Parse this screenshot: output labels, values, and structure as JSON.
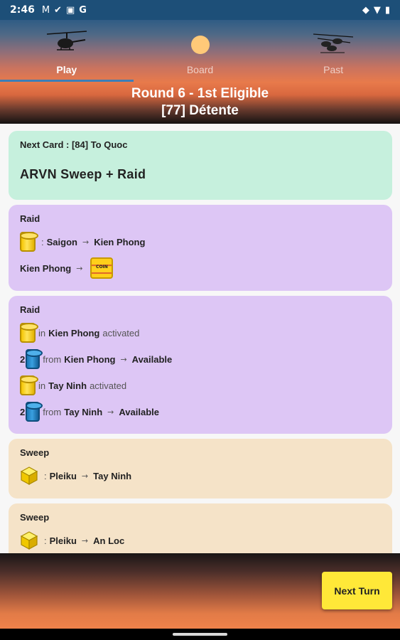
{
  "status_bar": {
    "time": "2:46",
    "icons_left": [
      "mail-icon",
      "check-icon",
      "image-icon",
      "google-icon"
    ],
    "icons_right": [
      "cast-icon",
      "wifi-icon",
      "battery-icon"
    ],
    "mail_glyph": "M",
    "check_glyph": "✔",
    "image_glyph": "▣",
    "google_glyph": "G",
    "cast_glyph": "◆",
    "wifi_glyph": "▼",
    "battery_glyph": "▮"
  },
  "tabs": [
    {
      "label": "Play",
      "active": true,
      "icon": "helicopter-icon"
    },
    {
      "label": "Board",
      "active": false,
      "icon": "sun-icon"
    },
    {
      "label": "Past",
      "active": false,
      "icon": "helicopters-icon"
    }
  ],
  "round": {
    "line1": "Round 6 - 1st Eligible",
    "line2": "[77] Détente"
  },
  "next_card": {
    "label": "Next Card : [84] To Quoc",
    "action": "ARVN  Sweep  +  Raid"
  },
  "raid1": {
    "title": "Raid",
    "line1": {
      "sep": ":",
      "from": "Saigon",
      "arrow": "→",
      "to": "Kien Phong"
    },
    "line2": {
      "from": "Kien Phong",
      "arrow": "→",
      "coin_text": "COIN"
    }
  },
  "raid2": {
    "title": "Raid",
    "row1": {
      "prefix": "in",
      "place": "Kien Phong",
      "suffix": "activated"
    },
    "row2": {
      "count": "2",
      "prefix": "from",
      "place": "Kien Phong",
      "arrow": "→",
      "to": "Available"
    },
    "row3": {
      "prefix": "in",
      "place": "Tay Ninh",
      "suffix": "activated"
    },
    "row4": {
      "count": "2",
      "prefix": "from",
      "place": "Tay Ninh",
      "arrow": "→",
      "to": "Available"
    }
  },
  "sweep1": {
    "title": "Sweep",
    "line": {
      "sep": ":",
      "from": "Pleiku",
      "arrow": "→",
      "to": "Tay Ninh"
    }
  },
  "sweep2": {
    "title": "Sweep",
    "line": {
      "sep": ":",
      "from": "Pleiku",
      "arrow": "→",
      "to": "An Loc"
    }
  },
  "next_turn_label": "Next Turn",
  "colors": {
    "card_green": "#c6f0dd",
    "card_purple": "#ddc6f5",
    "card_tan": "#f5e3c8",
    "button_yellow": "#ffe838",
    "arvn_yellow": "#f4c400",
    "vc_blue": "#1976b6"
  }
}
